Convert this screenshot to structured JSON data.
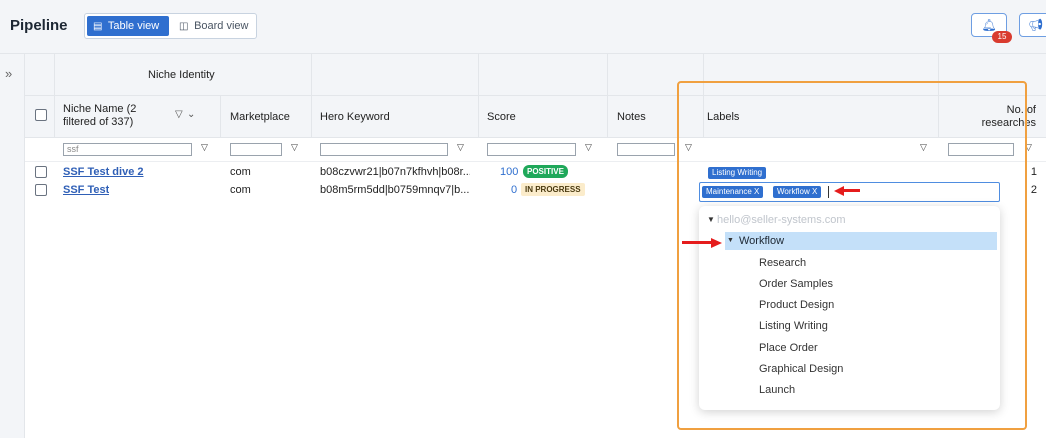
{
  "header": {
    "title": "Pipeline",
    "view_table_label": "Table view",
    "view_board_label": "Board view",
    "notification_count": "15"
  },
  "table": {
    "group_header": "Niche Identity",
    "columns": {
      "niche_name": "Niche Name (2",
      "niche_name_sub": "filtered of 337)",
      "marketplace": "Marketplace",
      "hero_keyword": "Hero Keyword",
      "score": "Score",
      "notes": "Notes",
      "labels": "Labels",
      "no_of": "No. of",
      "researches": "researches"
    },
    "filter_niche_value": "ssf",
    "rows": [
      {
        "name": "SSF Test dive 2",
        "marketplace": "com",
        "hero_keyword": "b08czvwr21|b07n7kfhvh|b08r...",
        "score": "100",
        "status": "POSITIVE",
        "label": "Listing Writing",
        "researches": "1"
      },
      {
        "name": "SSF Test",
        "marketplace": "com",
        "hero_keyword": "b08m5rm5dd|b0759mnqv7|b...",
        "score": "0",
        "status": "IN PROGRESS",
        "researches": "2"
      }
    ]
  },
  "label_editor": {
    "chips": [
      "Maintenance X",
      "Workflow X"
    ]
  },
  "dropdown": {
    "account": "hello@seller-systems.com",
    "group": "Workflow",
    "items": [
      "Research",
      "Order Samples",
      "Product Design",
      "Listing Writing",
      "Place Order",
      "Graphical Design",
      "Launch"
    ]
  },
  "colors": {
    "accent": "#2f6fcf",
    "positive": "#1fa85a",
    "highlight": "#f0a040",
    "arrow": "#e51c1c"
  }
}
